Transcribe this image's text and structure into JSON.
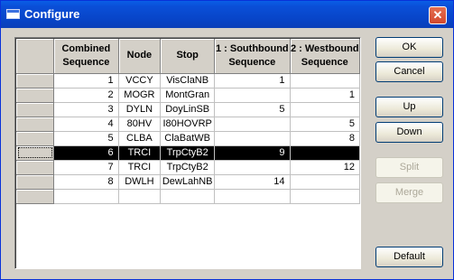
{
  "window": {
    "title": "Configure",
    "close_glyph": "✕"
  },
  "grid": {
    "columns": [
      "Combined Sequence",
      "Node",
      "Stop",
      "1 : Southbound Sequence",
      "2 : Westbound Sequence"
    ],
    "rows": [
      {
        "seq": "1",
        "node": "VCCY",
        "stop": "VisClaNB",
        "south": "1",
        "west": ""
      },
      {
        "seq": "2",
        "node": "MOGR",
        "stop": "MontGran",
        "south": "",
        "west": "1"
      },
      {
        "seq": "3",
        "node": "DYLN",
        "stop": "DoyLinSB",
        "south": "5",
        "west": ""
      },
      {
        "seq": "4",
        "node": "80HV",
        "stop": "I80HOVRP",
        "south": "",
        "west": "5"
      },
      {
        "seq": "5",
        "node": "CLBA",
        "stop": "ClaBatWB",
        "south": "",
        "west": "8"
      },
      {
        "seq": "6",
        "node": "TRCI",
        "stop": "TrpCtyB2",
        "south": "9",
        "west": ""
      },
      {
        "seq": "7",
        "node": "TRCI",
        "stop": "TrpCtyB2",
        "south": "",
        "west": "12"
      },
      {
        "seq": "8",
        "node": "DWLH",
        "stop": "DewLahNB",
        "south": "14",
        "west": ""
      }
    ],
    "selected_row": 6
  },
  "buttons": {
    "ok": "OK",
    "cancel": "Cancel",
    "up": "Up",
    "down": "Down",
    "split": "Split",
    "merge": "Merge",
    "default": "Default"
  }
}
